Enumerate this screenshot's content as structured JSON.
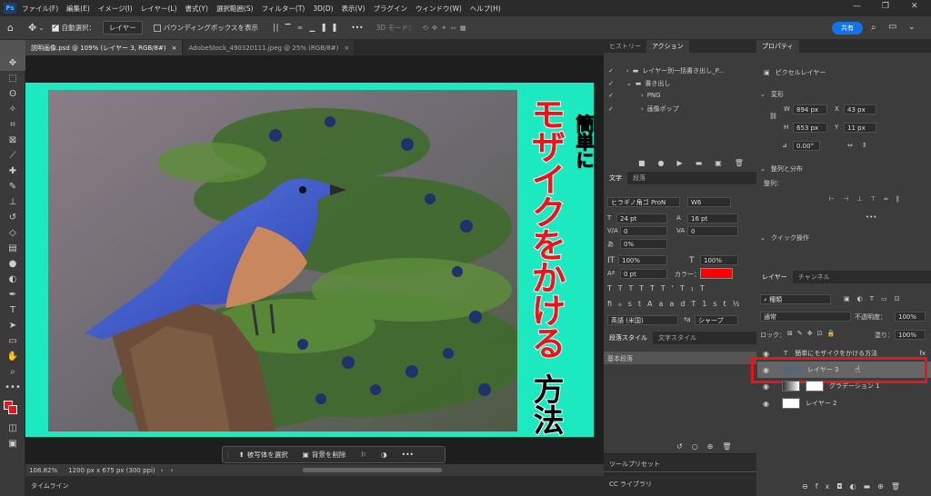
{
  "menubar": {
    "items": [
      "ファイル(F)",
      "編集(E)",
      "イメージ(I)",
      "レイヤー(L)",
      "書式(Y)",
      "選択範囲(S)",
      "フィルター(T)",
      "3D(D)",
      "表示(V)",
      "プラグイン",
      "ウィンドウ(W)",
      "ヘルプ(H)"
    ]
  },
  "options": {
    "auto_select": "自動選択：",
    "layer_dd": "レイヤー",
    "bbox": "バウンディングボックスを表示",
    "mode3d": "3D モード：",
    "share": "共有"
  },
  "tabs": [
    {
      "label": "説明画像.psd @ 109% (レイヤー 3, RGB/8#)"
    },
    {
      "label": "AdobeStock_490320111.jpeg @ 25% (RGB/8#)"
    }
  ],
  "canvas": {
    "title_main": "モザイクをかける",
    "title_tail": "方法",
    "title_sub": "簡単に",
    "accent": "#1de9c0",
    "text_red": "#e8151b"
  },
  "ctxbar": {
    "select_subject": "被写体を選択",
    "remove_bg": "背景を削除"
  },
  "status": {
    "zoom": "108.82%",
    "doc": "1200 px x 675 px (300 ppi)"
  },
  "timeline": {
    "label": "タイムライン"
  },
  "history": {
    "tabs": [
      "ヒストリー",
      "アクション"
    ],
    "items": [
      "レイヤー別一括書き出し_P...",
      "書き出し",
      "PNG",
      "画像ポップ"
    ]
  },
  "char": {
    "tabs": [
      "文字",
      "段落"
    ],
    "font": "ヒラギノ角ゴ ProN",
    "weight": "W6",
    "size": "24 pt",
    "leading": "16 pt",
    "kern": "0",
    "track": "0",
    "scale_v": "100%",
    "scale_h": "100%",
    "baseline": "0 pt",
    "color_label": "カラー：",
    "lang": "英語 (米国)",
    "aa": "シャープ",
    "color": "#ff0000"
  },
  "parastyle": {
    "tabs": [
      "段落スタイル",
      "文字スタイル"
    ],
    "item": "基本段落"
  },
  "toolpreset": {
    "label": "ツールプリセット"
  },
  "cclib": {
    "label": "CC ライブラリ"
  },
  "props": {
    "tab": "プロパティ",
    "type": "ピクセルレイヤー",
    "transform": "変形",
    "w": "894 px",
    "x": "43 px",
    "h": "653 px",
    "y": "11 px",
    "angle": "0.00°",
    "align": "整列と分布",
    "align_label": "整列：",
    "quick": "クイック操作"
  },
  "layers": {
    "tabs": [
      "レイヤー",
      "チャンネル"
    ],
    "kind": "種類",
    "blend": "通常",
    "opacity_label": "不透明度：",
    "opacity": "100%",
    "lock_label": "ロック：",
    "fill_label": "塗り：",
    "fill": "100%",
    "items": [
      {
        "name": "簡単にモザイクをかける方法",
        "type": "T",
        "fx": "fx"
      },
      {
        "name": "レイヤー 3"
      },
      {
        "name": "グラデーション 1"
      },
      {
        "name": "レイヤー 2"
      }
    ]
  }
}
